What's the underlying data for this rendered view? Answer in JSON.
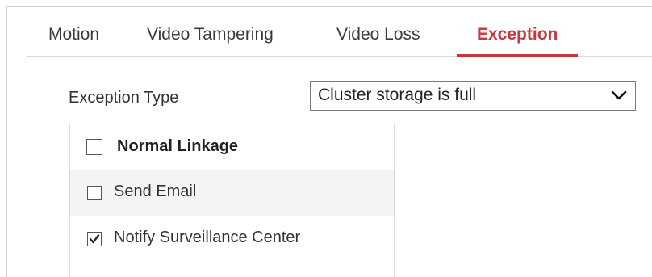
{
  "tabs": [
    {
      "label": "Motion",
      "active": false
    },
    {
      "label": "Video Tampering",
      "active": false
    },
    {
      "label": "Video Loss",
      "active": false
    },
    {
      "label": "Exception",
      "active": true
    }
  ],
  "exception_type": {
    "label": "Exception Type",
    "selected": "Cluster storage is full"
  },
  "linkage": {
    "header": {
      "label": "Normal Linkage",
      "checked": false
    },
    "items": [
      {
        "label": "Send Email",
        "checked": false
      },
      {
        "label": "Notify Surveillance Center",
        "checked": true
      }
    ]
  },
  "colors": {
    "accent": "#c7373b",
    "row_alt": "#f4f4f4",
    "border": "#d9d9d9"
  },
  "icons": {
    "select_arrow": "chevron-down-icon",
    "check": "checkmark-icon"
  }
}
